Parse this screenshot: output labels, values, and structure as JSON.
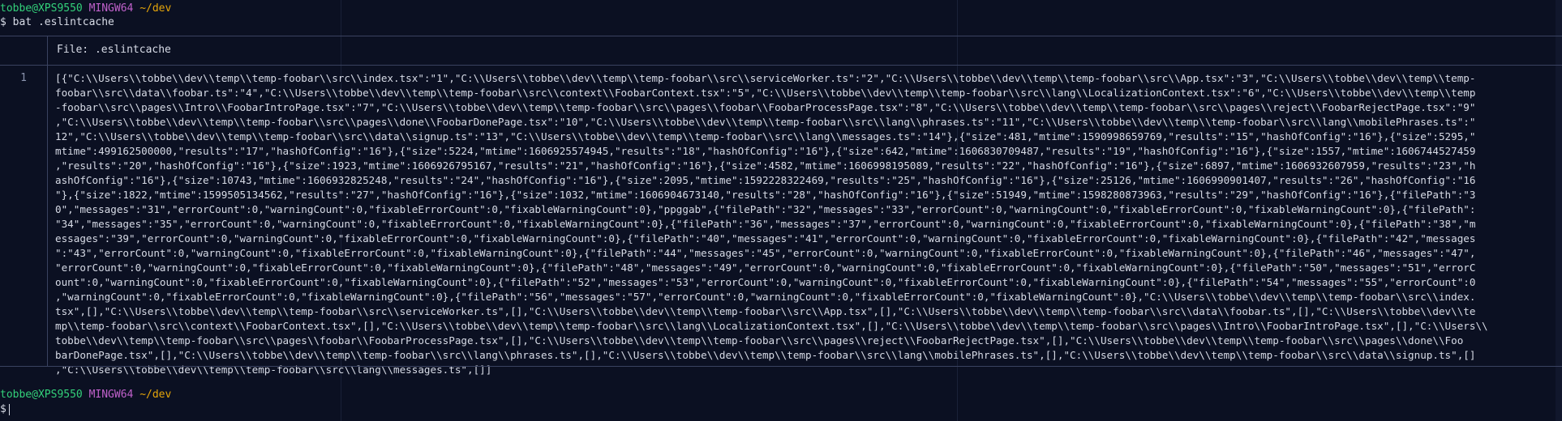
{
  "prompt1": {
    "user": "tobbe@XPS9550",
    "system": "MINGW64",
    "path": "~/dev",
    "symbol": "$",
    "command": "bat .eslintcache"
  },
  "file_header": "File: .eslintcache",
  "line_number": "1",
  "content_lines": [
    "[{\"C:\\\\Users\\\\tobbe\\\\dev\\\\temp\\\\temp-foobar\\\\src\\\\index.tsx\":\"1\",\"C:\\\\Users\\\\tobbe\\\\dev\\\\temp\\\\temp-foobar\\\\src\\\\serviceWorker.ts\":\"2\",\"C:\\\\Users\\\\tobbe\\\\dev\\\\temp\\\\temp-foobar\\\\src\\\\App.tsx\":\"3\",\"C:\\\\Users\\\\tobbe\\\\dev\\\\temp\\\\temp-",
    "foobar\\\\src\\\\data\\\\foobar.ts\":\"4\",\"C:\\\\Users\\\\tobbe\\\\dev\\\\temp\\\\temp-foobar\\\\src\\\\context\\\\FoobarContext.tsx\":\"5\",\"C:\\\\Users\\\\tobbe\\\\dev\\\\temp\\\\temp-foobar\\\\src\\\\lang\\\\LocalizationContext.tsx\":\"6\",\"C:\\\\Users\\\\tobbe\\\\dev\\\\temp\\\\temp",
    "-foobar\\\\src\\\\pages\\\\Intro\\\\FoobarIntroPage.tsx\":\"7\",\"C:\\\\Users\\\\tobbe\\\\dev\\\\temp\\\\temp-foobar\\\\src\\\\pages\\\\foobar\\\\FoobarProcessPage.tsx\":\"8\",\"C:\\\\Users\\\\tobbe\\\\dev\\\\temp\\\\temp-foobar\\\\src\\\\pages\\\\reject\\\\FoobarRejectPage.tsx\":\"9\"",
    ",\"C:\\\\Users\\\\tobbe\\\\dev\\\\temp\\\\temp-foobar\\\\src\\\\pages\\\\done\\\\FoobarDonePage.tsx\":\"10\",\"C:\\\\Users\\\\tobbe\\\\dev\\\\temp\\\\temp-foobar\\\\src\\\\lang\\\\phrases.ts\":\"11\",\"C:\\\\Users\\\\tobbe\\\\dev\\\\temp\\\\temp-foobar\\\\src\\\\lang\\\\mobilePhrases.ts\":\"",
    "12\",\"C:\\\\Users\\\\tobbe\\\\dev\\\\temp\\\\temp-foobar\\\\src\\\\data\\\\signup.ts\":\"13\",\"C:\\\\Users\\\\tobbe\\\\dev\\\\temp\\\\temp-foobar\\\\src\\\\lang\\\\messages.ts\":\"14\"},{\"size\":481,\"mtime\":1590998659769,\"results\":\"15\",\"hashOfConfig\":\"16\"},{\"size\":5295,\"",
    "mtime\":499162500000,\"results\":\"17\",\"hashOfConfig\":\"16\"},{\"size\":5224,\"mtime\":1606925574945,\"results\":\"18\",\"hashOfConfig\":\"16\"},{\"size\":642,\"mtime\":1606830709487,\"results\":\"19\",\"hashOfConfig\":\"16\"},{\"size\":1557,\"mtime\":1606744527459",
    ",\"results\":\"20\",\"hashOfConfig\":\"16\"},{\"size\":1923,\"mtime\":1606926795167,\"results\":\"21\",\"hashOfConfig\":\"16\"},{\"size\":4582,\"mtime\":1606998195089,\"results\":\"22\",\"hashOfConfig\":\"16\"},{\"size\":6897,\"mtime\":1606932607959,\"results\":\"23\",\"h",
    "ashOfConfig\":\"16\"},{\"size\":10743,\"mtime\":1606932825248,\"results\":\"24\",\"hashOfConfig\":\"16\"},{\"size\":2095,\"mtime\":1592228322469,\"results\":\"25\",\"hashOfConfig\":\"16\"},{\"size\":25126,\"mtime\":1606990901407,\"results\":\"26\",\"hashOfConfig\":\"16",
    "\"},{\"size\":1822,\"mtime\":1599505134562,\"results\":\"27\",\"hashOfConfig\":\"16\"},{\"size\":1032,\"mtime\":1606904673140,\"results\":\"28\",\"hashOfConfig\":\"16\"},{\"size\":51949,\"mtime\":1598280873963,\"results\":\"29\",\"hashOfConfig\":\"16\"},{\"filePath\":\"3",
    "0\",\"messages\":\"31\",\"errorCount\":0,\"warningCount\":0,\"fixableErrorCount\":0,\"fixableWarningCount\":0},\"ppggab\",{\"filePath\":\"32\",\"messages\":\"33\",\"errorCount\":0,\"warningCount\":0,\"fixableErrorCount\":0,\"fixableWarningCount\":0},{\"filePath\":",
    "\"34\",\"messages\":\"35\",\"errorCount\":0,\"warningCount\":0,\"fixableErrorCount\":0,\"fixableWarningCount\":0},{\"filePath\":\"36\",\"messages\":\"37\",\"errorCount\":0,\"warningCount\":0,\"fixableErrorCount\":0,\"fixableWarningCount\":0},{\"filePath\":\"38\",\"m",
    "essages\":\"39\",\"errorCount\":0,\"warningCount\":0,\"fixableErrorCount\":0,\"fixableWarningCount\":0},{\"filePath\":\"40\",\"messages\":\"41\",\"errorCount\":0,\"warningCount\":0,\"fixableErrorCount\":0,\"fixableWarningCount\":0},{\"filePath\":\"42\",\"messages",
    "\":\"43\",\"errorCount\":0,\"warningCount\":0,\"fixableErrorCount\":0,\"fixableWarningCount\":0},{\"filePath\":\"44\",\"messages\":\"45\",\"errorCount\":0,\"warningCount\":0,\"fixableErrorCount\":0,\"fixableWarningCount\":0},{\"filePath\":\"46\",\"messages\":\"47\",",
    "\"errorCount\":0,\"warningCount\":0,\"fixableErrorCount\":0,\"fixableWarningCount\":0},{\"filePath\":\"48\",\"messages\":\"49\",\"errorCount\":0,\"warningCount\":0,\"fixableErrorCount\":0,\"fixableWarningCount\":0},{\"filePath\":\"50\",\"messages\":\"51\",\"errorC",
    "ount\":0,\"warningCount\":0,\"fixableErrorCount\":0,\"fixableWarningCount\":0},{\"filePath\":\"52\",\"messages\":\"53\",\"errorCount\":0,\"warningCount\":0,\"fixableErrorCount\":0,\"fixableWarningCount\":0},{\"filePath\":\"54\",\"messages\":\"55\",\"errorCount\":0",
    ",\"warningCount\":0,\"fixableErrorCount\":0,\"fixableWarningCount\":0},{\"filePath\":\"56\",\"messages\":\"57\",\"errorCount\":0,\"warningCount\":0,\"fixableErrorCount\":0,\"fixableWarningCount\":0},\"C:\\\\Users\\\\tobbe\\\\dev\\\\temp\\\\temp-foobar\\\\src\\\\index.",
    "tsx\",[],\"C:\\\\Users\\\\tobbe\\\\dev\\\\temp\\\\temp-foobar\\\\src\\\\serviceWorker.ts\",[],\"C:\\\\Users\\\\tobbe\\\\dev\\\\temp\\\\temp-foobar\\\\src\\\\App.tsx\",[],\"C:\\\\Users\\\\tobbe\\\\dev\\\\temp\\\\temp-foobar\\\\src\\\\data\\\\foobar.ts\",[],\"C:\\\\Users\\\\tobbe\\\\dev\\\\te",
    "mp\\\\temp-foobar\\\\src\\\\context\\\\FoobarContext.tsx\",[],\"C:\\\\Users\\\\tobbe\\\\dev\\\\temp\\\\temp-foobar\\\\src\\\\lang\\\\LocalizationContext.tsx\",[],\"C:\\\\Users\\\\tobbe\\\\dev\\\\temp\\\\temp-foobar\\\\src\\\\pages\\\\Intro\\\\FoobarIntroPage.tsx\",[],\"C:\\\\Users\\\\",
    "tobbe\\\\dev\\\\temp\\\\temp-foobar\\\\src\\\\pages\\\\foobar\\\\FoobarProcessPage.tsx\",[],\"C:\\\\Users\\\\tobbe\\\\dev\\\\temp\\\\temp-foobar\\\\src\\\\pages\\\\reject\\\\FoobarRejectPage.tsx\",[],\"C:\\\\Users\\\\tobbe\\\\dev\\\\temp\\\\temp-foobar\\\\src\\\\pages\\\\done\\\\Foo",
    "barDonePage.tsx\",[],\"C:\\\\Users\\\\tobbe\\\\dev\\\\temp\\\\temp-foobar\\\\src\\\\lang\\\\phrases.ts\",[],\"C:\\\\Users\\\\tobbe\\\\dev\\\\temp\\\\temp-foobar\\\\src\\\\lang\\\\mobilePhrases.ts\",[],\"C:\\\\Users\\\\tobbe\\\\dev\\\\temp\\\\temp-foobar\\\\src\\\\data\\\\signup.ts\",[]",
    ",\"C:\\\\Users\\\\tobbe\\\\dev\\\\temp\\\\temp-foobar\\\\src\\\\lang\\\\messages.ts\",[]]"
  ],
  "prompt2": {
    "user": "tobbe@XPS9550",
    "system": "MINGW64",
    "path": "~/dev",
    "symbol": "$"
  }
}
